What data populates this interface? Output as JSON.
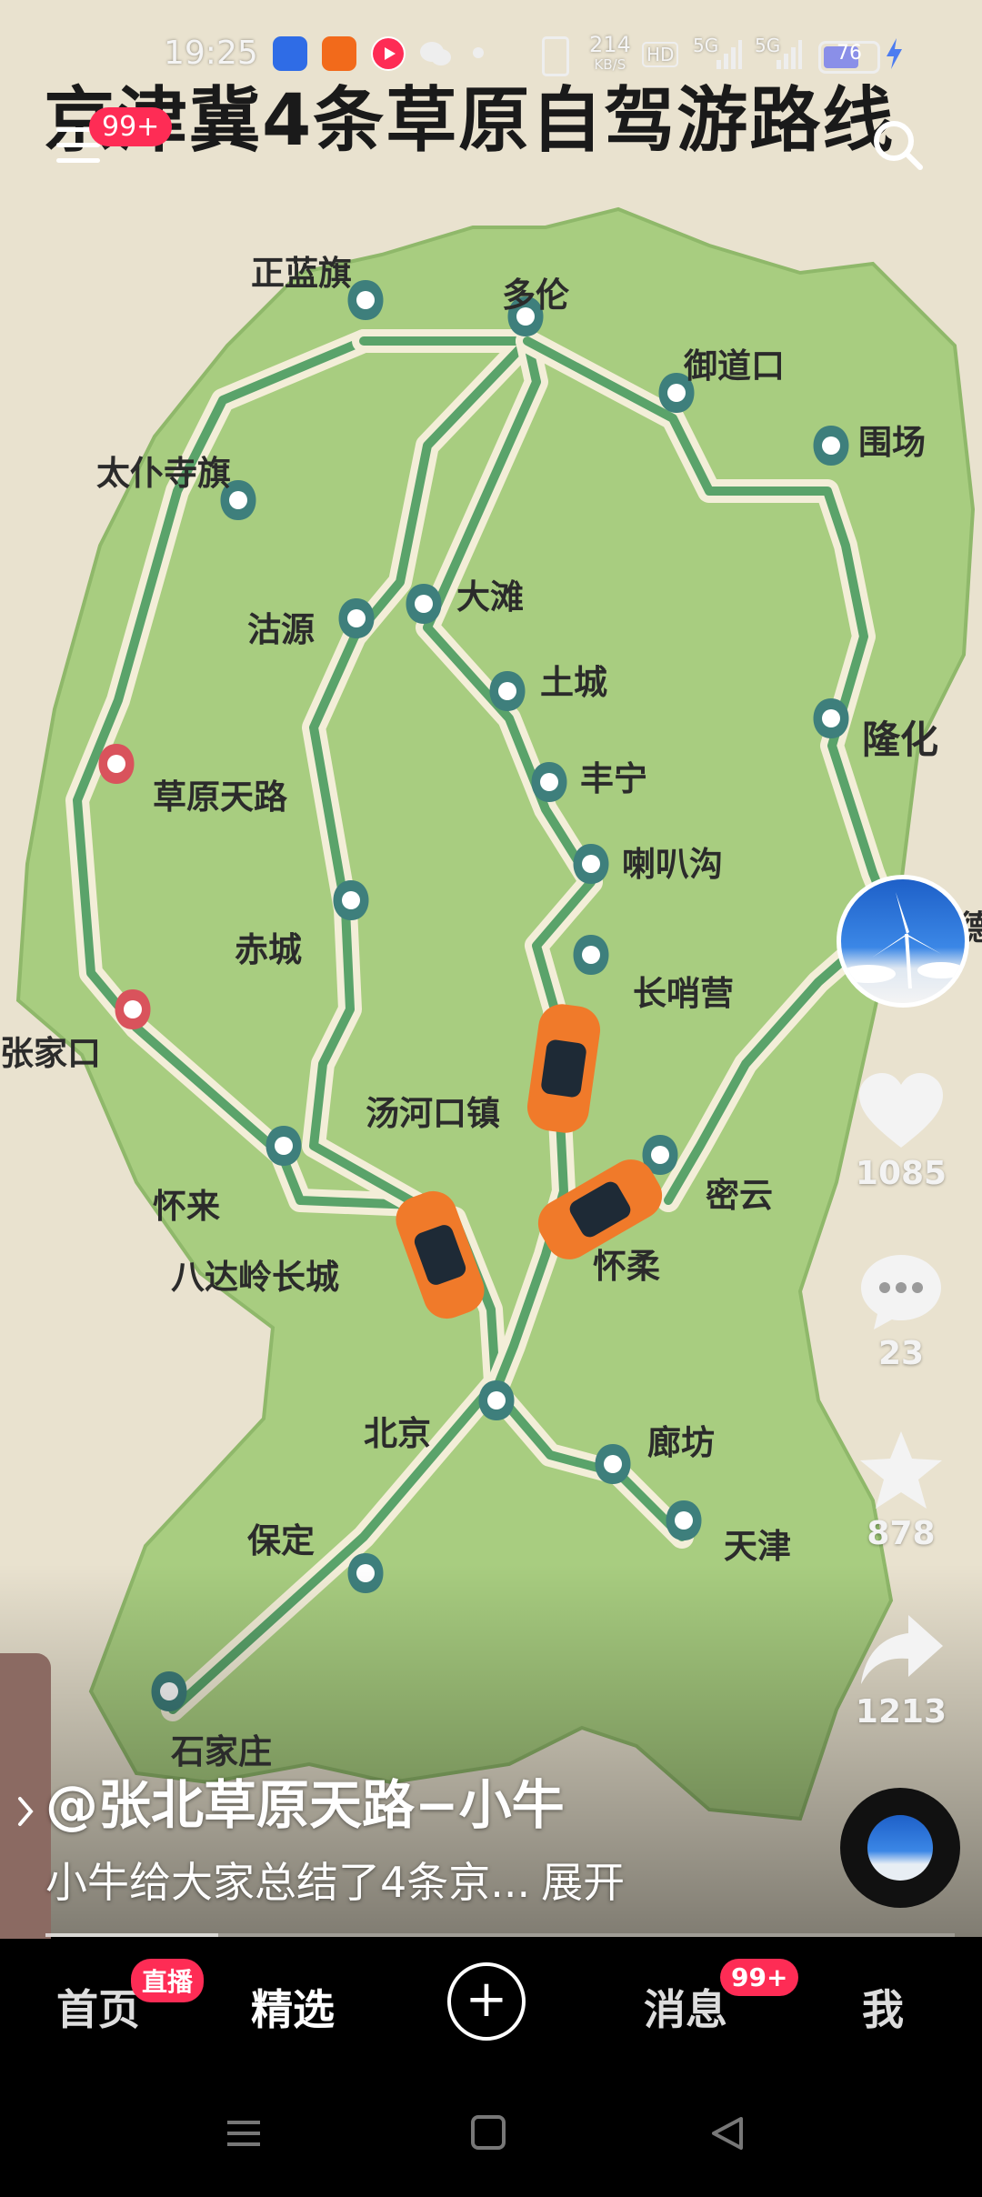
{
  "status_bar": {
    "time": "19:25",
    "net_speed_value": "214",
    "net_speed_unit": "KB/S",
    "hd_label": "HD",
    "signal_1": "5G",
    "signal_2": "5G",
    "battery": "76",
    "battery_level": 0.76
  },
  "video": {
    "map_title": "京津冀4条草原自驾游路线",
    "places": {
      "zhenglanqi": "正蓝旗",
      "duolun": "多伦",
      "yudaokou": "御道口",
      "weichang": "围场",
      "taipusiqi": "太仆寺旗",
      "guyuan": "沽源",
      "datan": "大滩",
      "tucheng": "土城",
      "longhua": "隆化",
      "caoyuantianlu": "草原天路",
      "fengning": "丰宁",
      "labagou": "喇叭沟",
      "chicheng": "赤城",
      "changshaoying": "长哨营",
      "zhangjiakou": "张家口",
      "tanghekouzhen": "汤河口镇",
      "miyun": "密云",
      "huailai": "怀来",
      "huairou": "怀柔",
      "badaling": "八达岭长城",
      "beijing": "北京",
      "langfang": "廊坊",
      "baoding": "保定",
      "tianjin": "天津",
      "shijiazhuang": "石家庄",
      "chengde_partial": "德"
    }
  },
  "top_nav": {
    "menu_badge": "99+"
  },
  "right_rail": {
    "likes": "1085",
    "comments": "23",
    "favorites": "878",
    "shares": "1213"
  },
  "caption": {
    "author": "@张北草原天路−小牛",
    "description": "小牛给大家总结了4条京...",
    "expand": "展开"
  },
  "progress": 0.19,
  "tab_bar": {
    "home": "首页",
    "home_badge": "直播",
    "featured": "精选",
    "plus": "+",
    "messages": "消息",
    "messages_badge": "99+",
    "me": "我"
  },
  "colors": {
    "map_green": "#a8cd80",
    "route_green": "#5aa36a",
    "pin_teal": "#3e7f7c",
    "pin_red": "#d9535c",
    "car_orange": "#f07a2a",
    "badge_red": "#fe2c55"
  }
}
